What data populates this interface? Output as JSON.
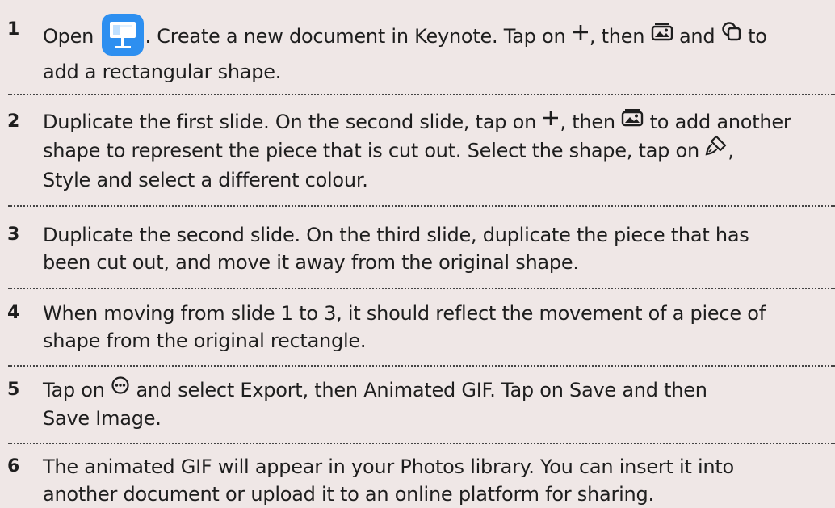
{
  "steps": [
    {
      "number": "1",
      "lines": [
        [
          "Open",
          ". Create a new document in Keynote. Tap on",
          ", then",
          "and",
          "to"
        ],
        [
          "add a rectangular shape."
        ]
      ]
    },
    {
      "number": "2",
      "lines": [
        [
          "Duplicate the first slide. On the second slide, tap on",
          ", then",
          "to add another"
        ],
        [
          "shape to represent the piece that is cut out. Select the shape, tap on",
          ","
        ],
        [
          "Style and select a different colour."
        ]
      ]
    },
    {
      "number": "3",
      "lines": [
        [
          "Duplicate the second slide. On the third slide, duplicate the piece that has"
        ],
        [
          "been cut out, and move it away from the original shape."
        ]
      ]
    },
    {
      "number": "4",
      "lines": [
        [
          "When moving from slide 1 to 3, it should reflect the movement of a piece of"
        ],
        [
          "shape from the original rectangle."
        ]
      ]
    },
    {
      "number": "5",
      "lines": [
        [
          "Tap on",
          "and select Export, then Animated GIF. Tap on Save and then"
        ],
        [
          "Save Image."
        ]
      ]
    },
    {
      "number": "6",
      "lines": [
        [
          "The animated GIF will appear in your Photos library. You can insert it into"
        ],
        [
          "another document or upload it to an online platform for sharing."
        ]
      ]
    }
  ],
  "icons": {
    "keynote": "keynote-app-icon",
    "plus": "plus-icon",
    "media": "media-icon",
    "shape": "shape-icon",
    "format": "format-brush-icon",
    "more": "more-icon"
  },
  "colors": {
    "background": "#efe7e6",
    "text": "#1e1e1e",
    "keynote_blue": "#2d8ff0"
  }
}
